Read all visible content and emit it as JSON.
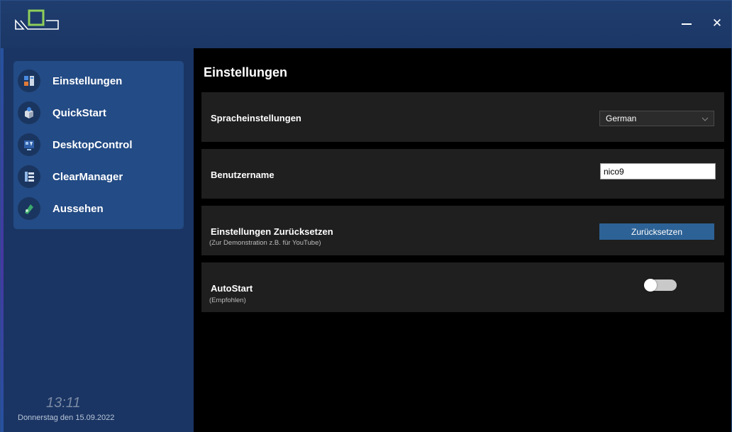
{
  "window": {
    "minimize_symbol": "",
    "close_symbol": "✕"
  },
  "sidebar": {
    "items": [
      {
        "label": "Einstellungen",
        "icon": "settings-icon"
      },
      {
        "label": "QuickStart",
        "icon": "quickstart-icon"
      },
      {
        "label": "DesktopControl",
        "icon": "desktop-control-icon"
      },
      {
        "label": "ClearManager",
        "icon": "clear-manager-icon"
      },
      {
        "label": "Aussehen",
        "icon": "appearance-icon"
      }
    ],
    "clock": "13:11",
    "date": "Donnerstag den 15.09.2022"
  },
  "main": {
    "title": "Einstellungen",
    "language": {
      "label": "Spracheinstellungen",
      "selected": "German"
    },
    "username": {
      "label": "Benutzername",
      "value": "nico9"
    },
    "reset": {
      "label": "Einstellungen Zurücksetzen",
      "sub": "(Zur Demonstration z.B. für YouTube)",
      "button": "Zurücksetzen"
    },
    "autostart": {
      "label": "AutoStart",
      "sub": "(Empfohlen)",
      "enabled": false
    }
  },
  "colors": {
    "accent": "#2d6296",
    "sidebar": "#1a3563",
    "nav_panel": "#234b85",
    "logo_green": "#8fce5a"
  }
}
